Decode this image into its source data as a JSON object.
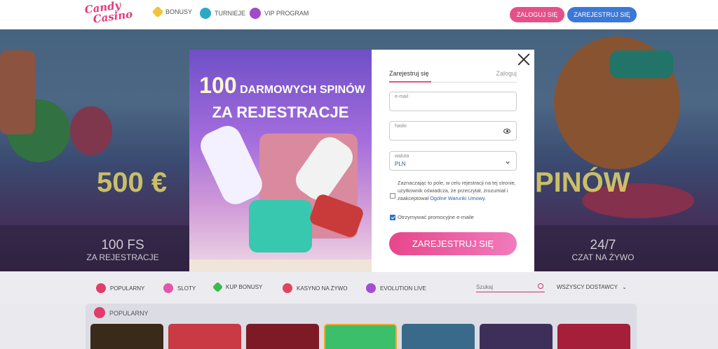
{
  "brand": {
    "logo_line1": "Candy",
    "logo_line2": "Casino"
  },
  "header": {
    "nav": [
      {
        "label": "BONUSY",
        "icon": "star-icon"
      },
      {
        "label": "TURNIEJE",
        "icon": "globe-icon"
      },
      {
        "label": "VIP PROGRAM",
        "icon": "vip-icon"
      }
    ],
    "login_label": "ZALOGUJ SIĘ",
    "register_label": "ZAREJESTRUJ SIĘ"
  },
  "hero": {
    "left_value": "500 €",
    "right_value": "PINÓW",
    "stat_left_big": "100 FS",
    "stat_left_small": "ZA REJESTRACJE",
    "stat_right_big": "24/7",
    "stat_right_small": "CZAT NA ŻYWO"
  },
  "categories": [
    {
      "label": "POPULARNY",
      "icon": "candy-icon"
    },
    {
      "label": "SLOTY",
      "icon": "lollipop-icon"
    },
    {
      "label": "KUP BONUSY",
      "icon": "gem-icon"
    },
    {
      "label": "KASYNO NA ŻYWO",
      "icon": "heart-candy-icon"
    },
    {
      "label": "EVOLUTION LIVE",
      "icon": "candy-cane-icon"
    }
  ],
  "search": {
    "placeholder": "Szukaj"
  },
  "providers_label": "WSZYSCY DOSTAWCY",
  "popular": {
    "title": "POPULARNY"
  },
  "modal": {
    "promo_number": "100",
    "promo_line1": "DARMOWYCH SPINÓW",
    "promo_line2": "ZA REJESTRACJE",
    "tab_register": "Zarejestruj się",
    "tab_login": "Zaloguj",
    "email_label": "e-mail",
    "password_label": "hasło",
    "currency_label": "waluta",
    "currency_value": "PLN",
    "consent_text": "Zaznaczając to pole, w celu rejestracji na tej stronie, użytkownik oświadcza, że przeczytał, zrozumiał i zaakceptował",
    "consent_link": "Ogólne Warunki Umowy.",
    "promo_email_label": "Otrzymywać promocyjne e-maile",
    "submit_label": "ZAREJESTRUJ SIĘ"
  },
  "colors": {
    "accent": "#e6508a",
    "blue": "#3b79d8"
  }
}
